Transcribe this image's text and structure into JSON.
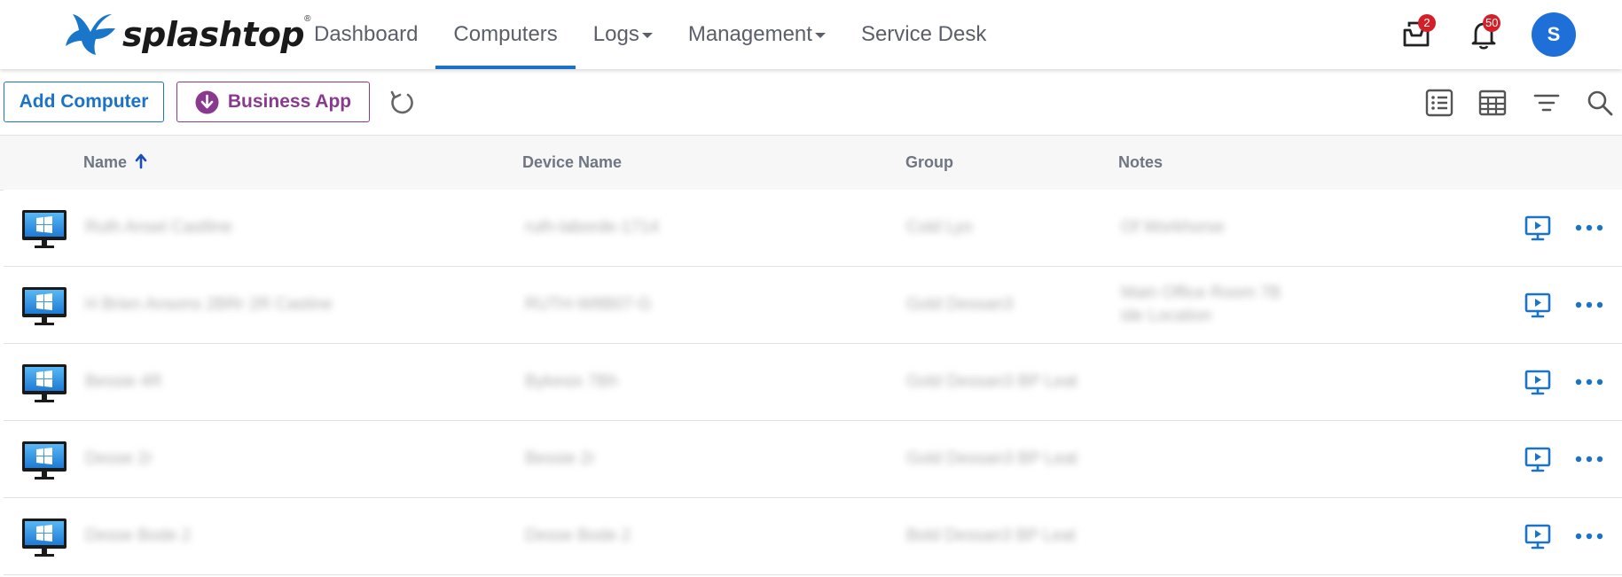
{
  "header": {
    "logo_text": "splashtop",
    "logo_mark": "®",
    "nav": [
      {
        "label": "Dashboard",
        "dropdown": false,
        "active": false
      },
      {
        "label": "Computers",
        "dropdown": false,
        "active": true
      },
      {
        "label": "Logs",
        "dropdown": true,
        "active": false
      },
      {
        "label": "Management",
        "dropdown": true,
        "active": false
      },
      {
        "label": "Service Desk",
        "dropdown": false,
        "active": false
      }
    ],
    "inbox_icon": "inbox-icon",
    "inbox_count": "2",
    "bell_icon": "bell-icon",
    "notification_count": "50",
    "avatar_initial": "S",
    "colors": {
      "accent": "#1a73c8",
      "badge": "#d32028",
      "avatar": "#1f6fd9"
    }
  },
  "toolbar": {
    "add_computer_label": "Add Computer",
    "business_app_label": "Business App",
    "business_app_color": "#8a3a8e",
    "icons": [
      "refresh-icon",
      "list-view-icon",
      "grid-view-icon",
      "filter-icon",
      "search-icon"
    ]
  },
  "table": {
    "columns": {
      "name": "Name",
      "device_name": "Device Name",
      "group": "Group",
      "notes": "Notes"
    },
    "sort": {
      "column": "Name",
      "direction": "ascending"
    },
    "rows": [
      {
        "name": "Ruth Ansel Castline",
        "device": "ruth-laborde-1714",
        "group": "Cold Lyo",
        "notes": [
          "Of Workhorse"
        ],
        "os_icon": "windows-monitor-icon"
      },
      {
        "name": "H Brien Ansons 2BRr 2R Castine",
        "device": "RUTH-W8B07-G",
        "group": "Gold Dessan3",
        "notes": [
          "Main Office Room 7B",
          "ide Location"
        ],
        "os_icon": "windows-monitor-icon"
      },
      {
        "name": "Bessie 4R",
        "device": "Bykesix 7Bh",
        "group": "Gold Dessan3 BP Leat",
        "notes": [],
        "os_icon": "windows-monitor-icon"
      },
      {
        "name": "Desse 2r",
        "device": "Bessie 2r",
        "group": "Gold Dessan3 BP Leat",
        "notes": [],
        "os_icon": "windows-monitor-icon"
      },
      {
        "name": "Desse Bode 2",
        "device": "Desse Bode 2",
        "group": "Bold Dessan3 BP Leat",
        "notes": [],
        "os_icon": "windows-monitor-icon"
      }
    ],
    "row_actions": [
      "remote-session-icon",
      "more-options-icon"
    ]
  }
}
